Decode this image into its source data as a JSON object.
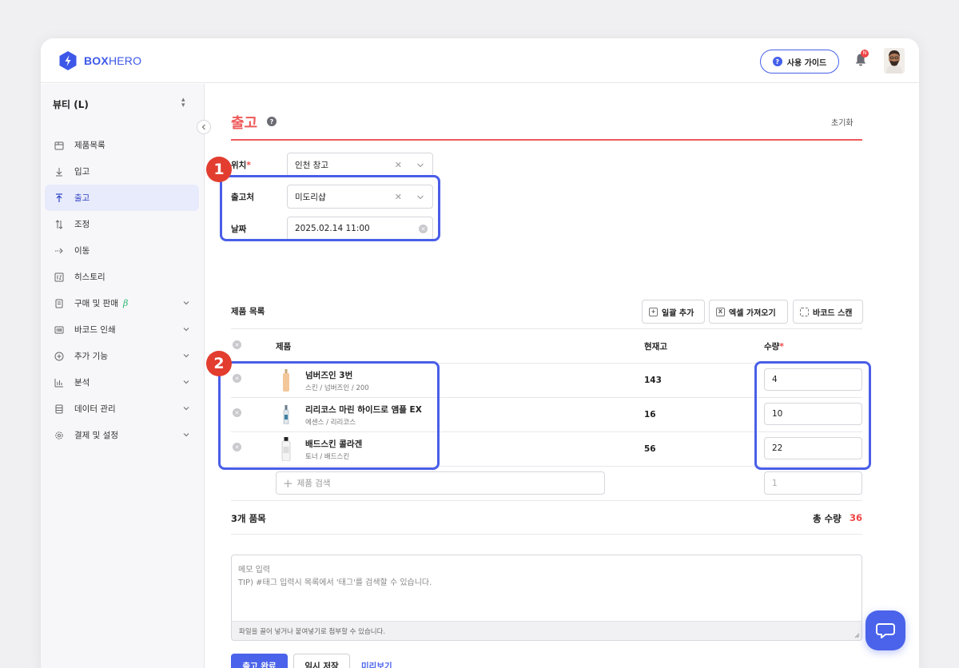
{
  "app": {
    "brand_bold": "BOX",
    "brand_light": "HERO",
    "guide_label": "사용 가이드",
    "notification_count": "N",
    "colors": {
      "accent": "#4a63ea",
      "title_red": "#ef5a5a",
      "highlight": "#4a5ee8",
      "badge_red": "#e23d2f"
    }
  },
  "sidebar": {
    "store_name": "뷰티 (L)",
    "items": [
      {
        "label": "제품목록",
        "icon": "box-icon",
        "expandable": false,
        "active": false
      },
      {
        "label": "입고",
        "icon": "arrow-down-icon",
        "expandable": false,
        "active": false
      },
      {
        "label": "출고",
        "icon": "arrow-up-icon",
        "expandable": false,
        "active": true
      },
      {
        "label": "조정",
        "icon": "adjust-icon",
        "expandable": false,
        "active": false
      },
      {
        "label": "이동",
        "icon": "arrow-right-icon",
        "expandable": false,
        "active": false
      },
      {
        "label": "히스토리",
        "icon": "history-icon",
        "expandable": false,
        "active": false
      },
      {
        "label": "구매 및 판매",
        "icon": "document-icon",
        "expandable": true,
        "active": false,
        "badge": "β"
      },
      {
        "label": "바코드 인쇄",
        "icon": "barcode-icon",
        "expandable": true,
        "active": false
      },
      {
        "label": "추가 기능",
        "icon": "plus-circle-icon",
        "expandable": true,
        "active": false
      },
      {
        "label": "분석",
        "icon": "chart-icon",
        "expandable": true,
        "active": false
      },
      {
        "label": "데이터 관리",
        "icon": "database-icon",
        "expandable": true,
        "active": false
      },
      {
        "label": "결제 및 설정",
        "icon": "gear-icon",
        "expandable": true,
        "active": false
      }
    ]
  },
  "page": {
    "title": "출고",
    "reset_label": "초기화",
    "location": {
      "label": "위치",
      "required_mark": "*",
      "value": "인천 창고"
    },
    "destination": {
      "label": "출고처",
      "value": "미도리샵"
    },
    "date": {
      "label": "날짜",
      "value": "2025.02.14 11:00"
    },
    "annotations": [
      "1",
      "2"
    ],
    "product_list_label": "제품 목록",
    "tools": {
      "bulk_add": "일괄 추가",
      "excel_import": "엑셀 가져오기",
      "barcode_scan": "바코드 스캔"
    },
    "columns": {
      "product": "제품",
      "stock": "현재고",
      "qty": "수량",
      "qty_required": "*"
    },
    "rows": [
      {
        "name": "넘버즈인 3번",
        "sub": "스킨 / 넘버즈인 / 200",
        "stock": "143",
        "qty": "4"
      },
      {
        "name": "리리코스 마린 하이드로 앰플 EX",
        "sub": "에센스 / 리리코스",
        "stock": "16",
        "qty": "10"
      },
      {
        "name": "배드스킨 콜라겐",
        "sub": "토너 / 배드스킨",
        "stock": "56",
        "qty": "22"
      }
    ],
    "search_placeholder": "제품 검색",
    "qty_placeholder": "1",
    "item_count": "3개 품목",
    "total_label": "총 수량",
    "total_value": "36",
    "memo_placeholder_1": "메모 입력",
    "memo_placeholder_2": "TIP) #태그 입력시 목록에서 '태그'를 검색할 수 있습니다.",
    "memo_footer": "파일을 끌어 넣거나 붙여넣기로 첨부할 수 있습니다.",
    "submit_label": "출고 완료",
    "draft_label": "임시 저장",
    "preview_label": "미리보기"
  }
}
